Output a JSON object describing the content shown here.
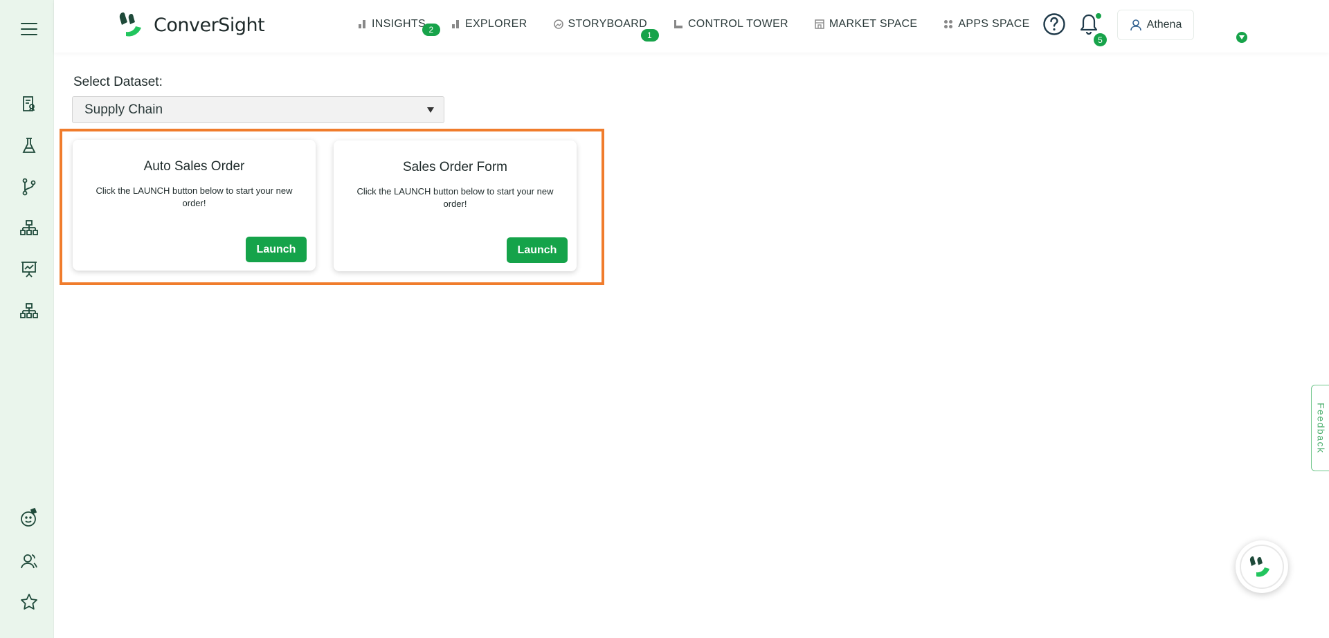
{
  "header": {
    "logo_text": "ConverSight",
    "nav": [
      {
        "label": "INSIGHTS",
        "icon": "bar-chart-icon",
        "badge": "2"
      },
      {
        "label": "EXPLORER",
        "icon": "bar-chart-icon",
        "badge": ""
      },
      {
        "label": "STORYBOARD",
        "icon": "storyboard-icon",
        "badge": "1"
      },
      {
        "label": "CONTROL TOWER",
        "icon": "control-tower-icon",
        "badge": ""
      },
      {
        "label": "MARKET SPACE",
        "icon": "market-space-icon",
        "badge": ""
      },
      {
        "label": "APPS SPACE",
        "icon": "apps-grid-icon",
        "badge": ""
      }
    ],
    "notifications_count": "5",
    "user_name": "Athena"
  },
  "sidebar": {
    "items": [
      "menu-icon",
      "report-icon",
      "flask-icon",
      "branch-icon",
      "hierarchy-icon",
      "presentation-chart-icon",
      "hierarchy-icon",
      "bot-icon",
      "users-icon",
      "star-icon"
    ]
  },
  "main": {
    "dataset_label": "Select Dataset:",
    "dataset_value": "Supply Chain",
    "cards": [
      {
        "title": "Auto Sales Order",
        "description": "Click the LAUNCH button below to start your new order!",
        "button": "Launch"
      },
      {
        "title": "Sales Order Form",
        "description": "Click the LAUNCH button below to start your new order!",
        "button": "Launch"
      }
    ]
  },
  "feedback_label": "Feedback",
  "colors": {
    "accent": "#15a34a",
    "sidebar_bg": "#eaf5ec",
    "highlight": "#f07c2c",
    "icon_dark": "#1f4a3a"
  }
}
